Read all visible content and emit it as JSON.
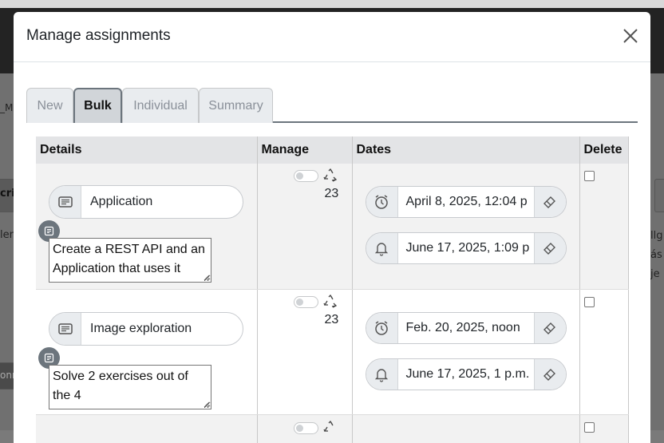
{
  "modal": {
    "title": "Manage assignments",
    "tabs": [
      {
        "label": "New",
        "active": false
      },
      {
        "label": "Bulk",
        "active": true
      },
      {
        "label": "Individual",
        "active": false
      },
      {
        "label": "Summary",
        "active": false
      }
    ]
  },
  "table": {
    "headers": {
      "details": "Details",
      "manage": "Manage",
      "dates": "Dates",
      "delete": "Delete"
    },
    "rows": [
      {
        "name": "Application",
        "description": "Create a REST API and an Application that uses it",
        "manage_enabled": false,
        "count": "23",
        "start_date": "April 8, 2025, 12:04 p",
        "due_date": "June 17, 2025, 1:09 p",
        "delete": false
      },
      {
        "name": "Image exploration",
        "description": "Solve 2 exercises out of the 4",
        "manage_enabled": false,
        "count": "23",
        "start_date": "Feb. 20, 2025, noon",
        "due_date": "June 17, 2025, 1 p.m.",
        "delete": false
      }
    ]
  },
  "background": {
    "left_fragments": [
      "_M",
      "crip",
      "len",
      "onn"
    ],
    "right_fragments": [
      "llg",
      "ás",
      "je"
    ]
  },
  "icons": {
    "close": "close-icon",
    "description": "text-lines-icon",
    "note": "note-icon",
    "recycle": "recycle-icon",
    "start": "alarm-clock-icon",
    "due": "bell-icon",
    "clear": "eraser-icon"
  },
  "colors": {
    "active_tab_border": "#6c757d",
    "header_bg": "#e3e4e6",
    "badge": "#6c757d"
  }
}
